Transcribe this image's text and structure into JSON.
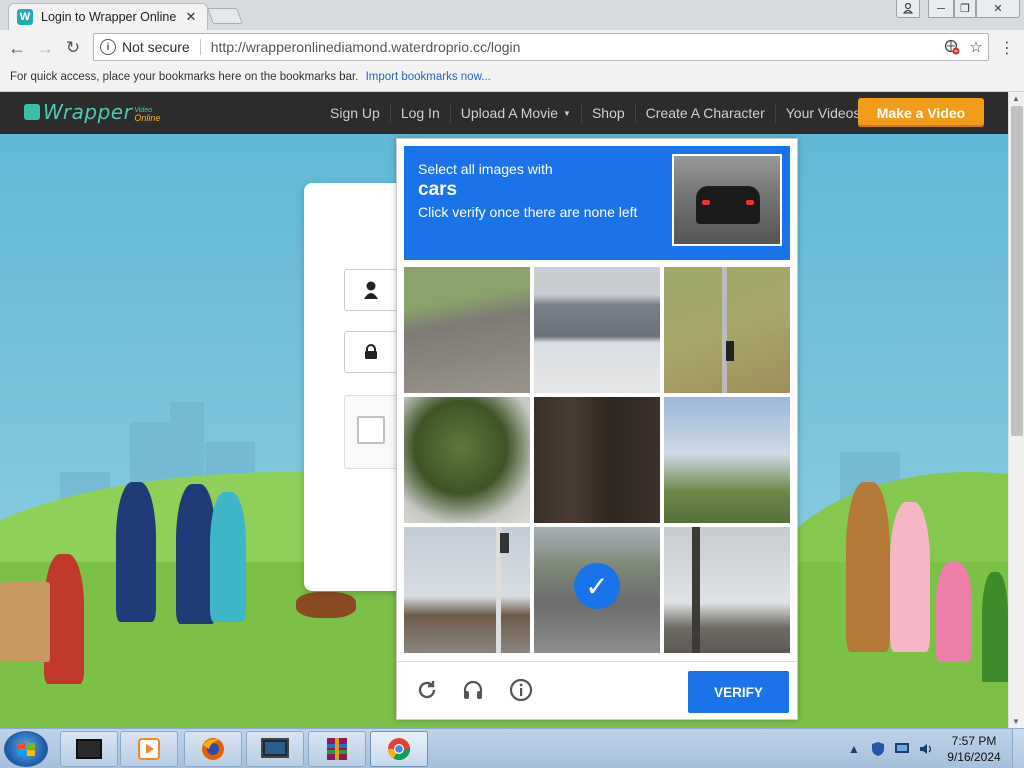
{
  "browser": {
    "tab_title": "Login to Wrapper Online",
    "tab_favicon": "W",
    "security_label": "Not secure",
    "url": "http://wrapperonlinediamond.waterdroprio.cc/login",
    "bookmarks_text": "For quick access, place your bookmarks here on the bookmarks bar.",
    "bookmarks_link": "Import bookmarks now..."
  },
  "site": {
    "logo_text": "Wrapper",
    "logo_tag_top": "Video",
    "logo_tag_bottom": "Online",
    "nav": [
      "Sign Up",
      "Log In",
      "Upload A Movie",
      "Shop",
      "Create A Character",
      "Your Videos"
    ],
    "cta": "Make a Video"
  },
  "captcha": {
    "line1": "Select all images with",
    "keyword": "cars",
    "line3": "Click verify once there are none left",
    "verify": "VERIFY",
    "tiles": [
      {
        "name": "road-grass",
        "selected": false
      },
      {
        "name": "house-roof",
        "selected": false
      },
      {
        "name": "traffic-light-hill",
        "selected": false
      },
      {
        "name": "palm-tree",
        "selected": false
      },
      {
        "name": "dark-fence",
        "selected": false
      },
      {
        "name": "palm-sky",
        "selected": false
      },
      {
        "name": "traffic-light-building",
        "selected": false
      },
      {
        "name": "road-trees",
        "selected": true
      },
      {
        "name": "pole-sky",
        "selected": false
      }
    ]
  },
  "taskbar": {
    "time": "7:57 PM",
    "date": "9/16/2024"
  },
  "colors": {
    "accent": "#1a73e8",
    "cta": "#f39c1c",
    "nav_bg": "#2c2c2c"
  }
}
